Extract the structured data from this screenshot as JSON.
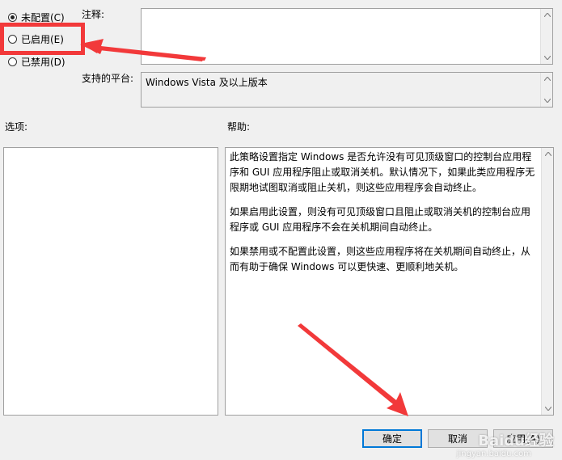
{
  "policy": {
    "options": [
      {
        "label": "未配置(C)",
        "checked": true
      },
      {
        "label": "已启用(E)",
        "checked": false
      },
      {
        "label": "已禁用(D)",
        "checked": false
      }
    ],
    "comment_label": "注释:",
    "comment_value": "",
    "supported_label": "支持的平台:",
    "supported_value": "Windows Vista 及以上版本",
    "options_label": "选项:",
    "help_label": "帮助:",
    "help_paragraphs": [
      "此策略设置指定 Windows 是否允许没有可见顶级窗口的控制台应用程序和 GUI 应用程序阻止或取消关机。默认情况下，如果此类应用程序无限期地试图取消或阻止关机，则这些应用程序会自动终止。",
      "如果启用此设置，则没有可见顶级窗口且阻止或取消关机的控制台应用程序或 GUI 应用程序不会在关机期间自动终止。",
      "如果禁用或不配置此设置，则这些应用程序将在关机期间自动终止，从而有助于确保 Windows 可以更快速、更顺利地关机。"
    ]
  },
  "buttons": {
    "ok": "确定",
    "cancel": "取消",
    "apply": "应用(A)"
  },
  "watermark": {
    "brand": "Baidu经验",
    "url": "jingyan.baidu.com"
  },
  "colors": {
    "annotation_red": "#f2393a",
    "window_bg": "#f0f0f0",
    "default_button_border": "#0078d7"
  },
  "icons": [
    "radio-icon",
    "scroll-up-icon",
    "scroll-down-icon",
    "annotation-arrow-icon"
  ]
}
